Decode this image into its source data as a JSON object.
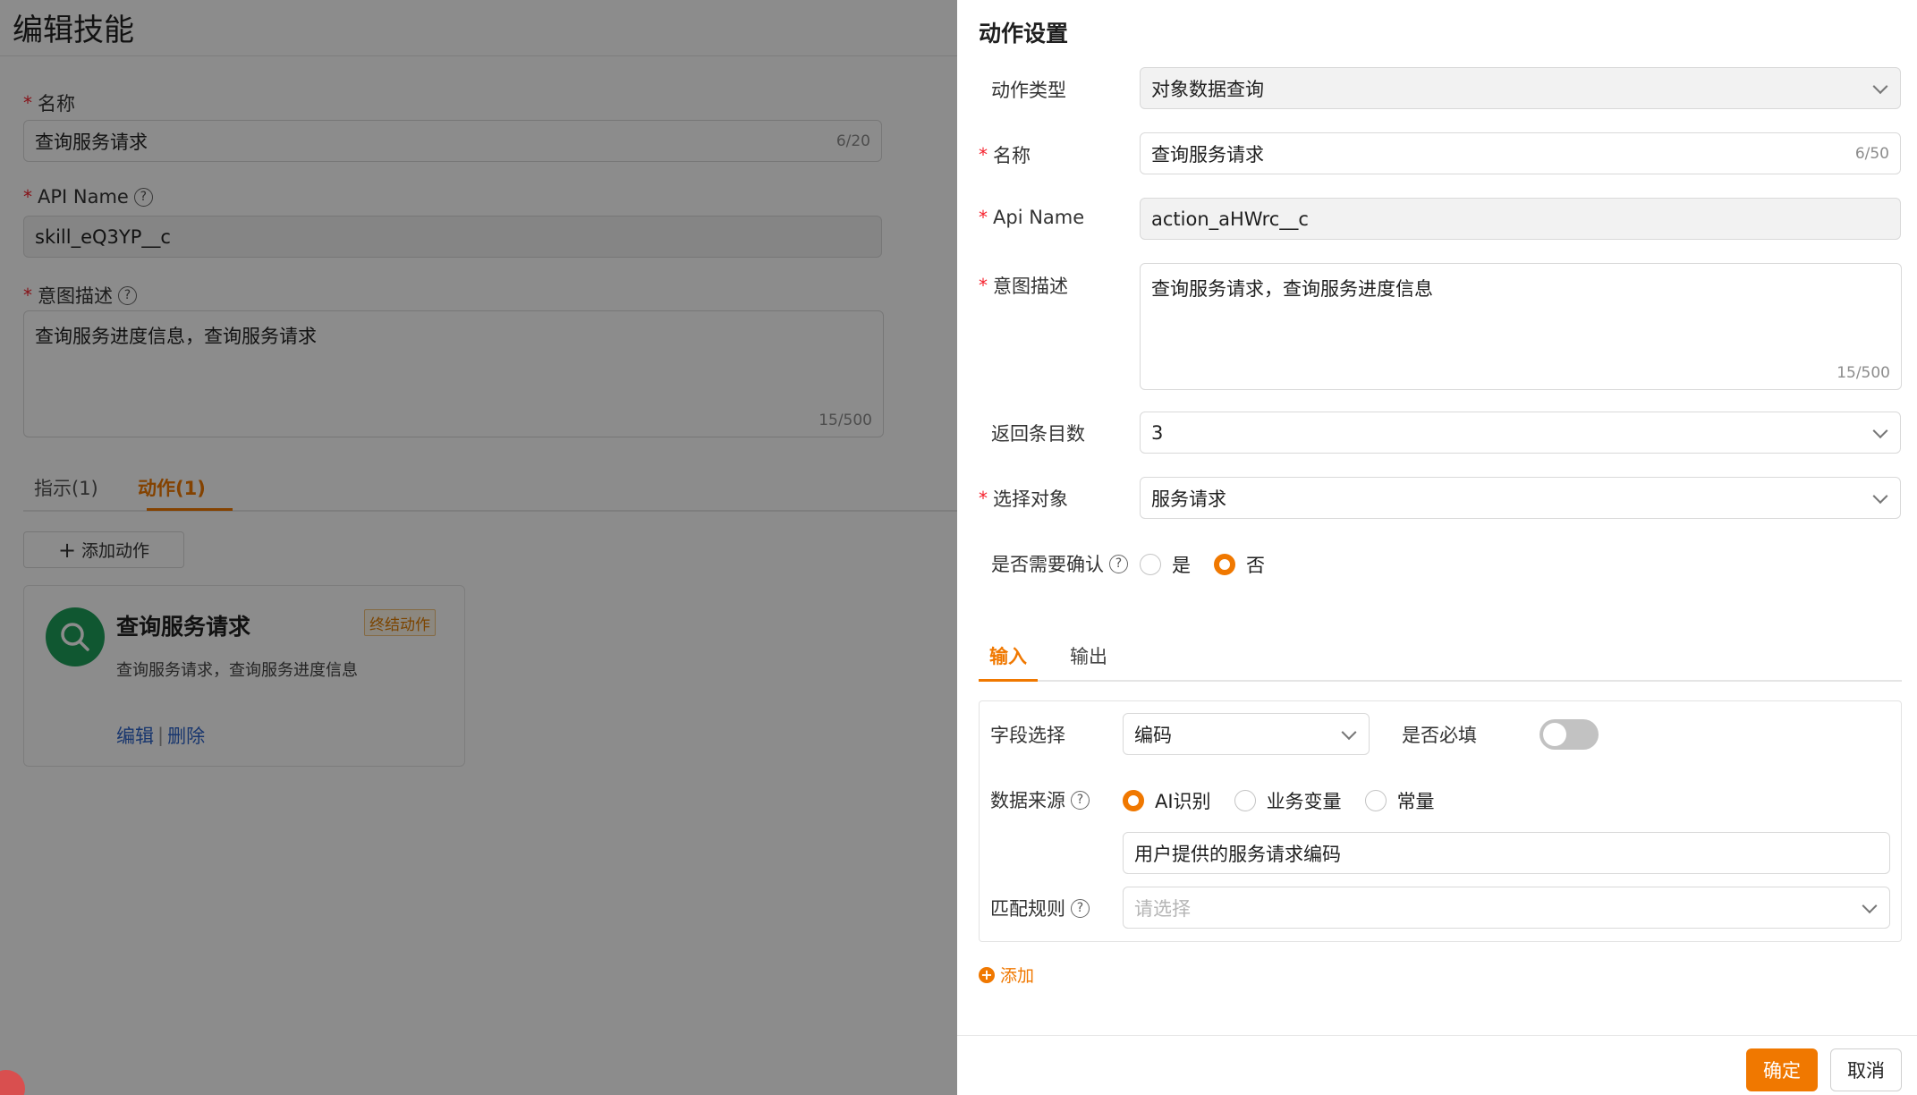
{
  "background": {
    "title": "编辑技能",
    "name_label": "名称",
    "name_value": "查询服务请求",
    "name_count": "6/20",
    "api_label": "API Name",
    "api_value": "skill_eQ3YP__c",
    "intent_label": "意图描述",
    "intent_value": "查询服务进度信息，查询服务请求",
    "intent_count": "15/500",
    "tabs": [
      {
        "label": "指示(1)"
      },
      {
        "label": "动作(1)"
      }
    ],
    "add_action_label": "添加动作",
    "card": {
      "title": "查询服务请求",
      "badge": "终结动作",
      "desc": "查询服务请求，查询服务进度信息",
      "edit": "编辑",
      "delete": "删除"
    }
  },
  "drawer": {
    "title": "动作设置",
    "action_type_label": "动作类型",
    "action_type_value": "对象数据查询",
    "name_label": "名称",
    "name_value": "查询服务请求",
    "name_count": "6/50",
    "api_label": "Api Name",
    "api_value": "action_aHWrc__c",
    "intent_label": "意图描述",
    "intent_value": "查询服务请求，查询服务进度信息",
    "intent_count": "15/500",
    "return_label": "返回条目数",
    "return_value": "3",
    "object_label": "选择对象",
    "object_value": "服务请求",
    "confirm_label": "是否需要确认",
    "confirm_options": [
      {
        "label": "是",
        "checked": false
      },
      {
        "label": "否",
        "checked": true
      }
    ],
    "sub_tabs": [
      {
        "label": "输入"
      },
      {
        "label": "输出"
      }
    ],
    "field": {
      "field_select_label": "字段选择",
      "field_select_value": "编码",
      "required_label": "是否必填",
      "required_on": false,
      "source_label": "数据来源",
      "source_options": [
        {
          "label": "AI识别",
          "checked": true
        },
        {
          "label": "业务变量",
          "checked": false
        },
        {
          "label": "常量",
          "checked": false
        }
      ],
      "source_input_value": "用户提供的服务请求编码",
      "match_label": "匹配规则",
      "match_placeholder": "请选择"
    },
    "add_label": "添加",
    "ok_label": "确定",
    "cancel_label": "取消"
  },
  "colors": {
    "accent": "#f07800",
    "required": "#f5222d",
    "link": "#2d63c8",
    "avatar": "#1e9e5a"
  }
}
